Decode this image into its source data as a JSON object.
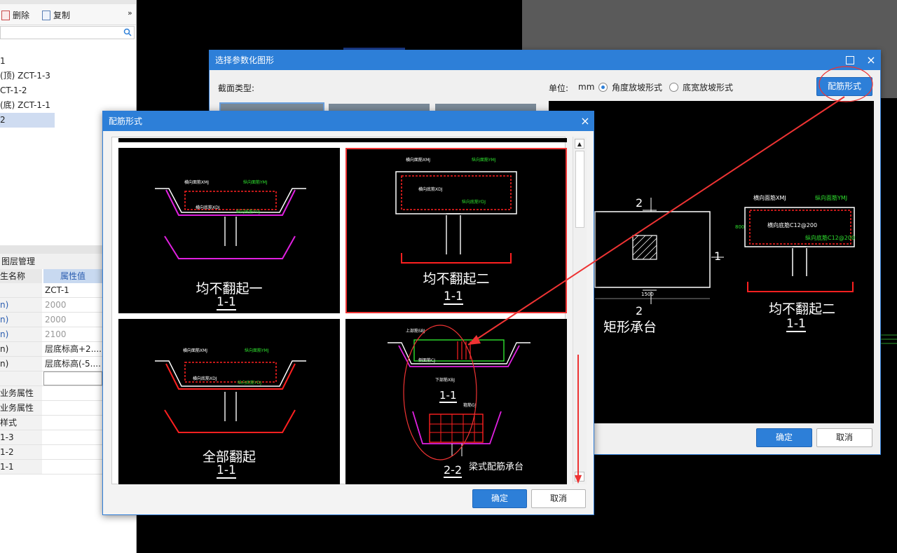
{
  "toolbar": {
    "delete": "删除",
    "copy": "复制",
    "more": "»"
  },
  "tree_items": [
    {
      "label": "1"
    },
    {
      "label": "(顶) ZCT-1-3"
    },
    {
      "label": "CT-1-2"
    },
    {
      "label": "(底) ZCT-1-1"
    },
    {
      "label": "2"
    }
  ],
  "props": {
    "tab_label": "图层管理",
    "header_name": "生名称",
    "header_value": "属性值",
    "rows": [
      {
        "k": "",
        "v": "ZCT-1"
      },
      {
        "k": "n)",
        "v": "2000"
      },
      {
        "k": "n)",
        "v": "2000"
      },
      {
        "k": "n)",
        "v": "2100"
      },
      {
        "k": "n)",
        "v": "层底标高+2...."
      },
      {
        "k": "n)",
        "v": "层底标高(-5...."
      },
      {
        "k": "",
        "v": ""
      },
      {
        "k": "业务属性",
        "v": ""
      },
      {
        "k": "业务属性",
        "v": ""
      },
      {
        "k": "样式",
        "v": ""
      },
      {
        "k": "1-3",
        "v": ""
      },
      {
        "k": "1-2",
        "v": ""
      },
      {
        "k": "1-1",
        "v": ""
      }
    ]
  },
  "dialog_param": {
    "title": "选择参数化图形",
    "section_type_label": "截面类型:",
    "unit_label": "单位:",
    "unit_value": "mm",
    "radio_angle": "角度放坡形式",
    "radio_width": "底宽放坡形式",
    "rebar_button": "配筋形式",
    "ok": "确定",
    "cancel": "取消",
    "preview": {
      "rect_title": "矩形承台",
      "rect_num_top": "2",
      "rect_num_bottom": "2",
      "rect_num_right": "1",
      "dim_1500": "1500",
      "pile_title": "均不翻起二",
      "pile_section": "1-1",
      "ann_xmj": "横向面筋XMJ",
      "ann_ymj": "纵向面筋YMJ",
      "ann_xdj": "横向底筋C12@200",
      "ann_ydj": "纵向底筋C12@200",
      "dim_800": "800"
    }
  },
  "dialog_rebar": {
    "title": "配筋形式",
    "ok": "确定",
    "cancel": "取消",
    "cells": [
      {
        "name": "均不翻起一",
        "section": "1-1",
        "xmj": "横向面筋XMJ",
        "ymj": "纵向面筋YMJ",
        "xdj": "横向底筋XDJ",
        "ydj": "纵向底筋YDJ"
      },
      {
        "name": "均不翻起二",
        "section": "1-1",
        "xmj": "横向面筋XMJ",
        "ymj": "纵向面筋YMJ",
        "xdj": "横向底筋XDJ",
        "ydj": "纵向底筋YDJ"
      },
      {
        "name": "全部翻起",
        "section": "1-1",
        "xmj": "横向面筋XMJ",
        "ymj": "纵向面筋YMJ",
        "xdj": "横向底筋XDJ",
        "ydj": "纵向底筋YDJ"
      },
      {
        "name": "梁式配筋承台",
        "section": "1-1",
        "section2": "2-2",
        "top": "上部筋SBJ",
        "bottom": "下部筋XBJ",
        "side": "侧面筋CJ",
        "stirrup": "箍筋GJ"
      }
    ]
  },
  "colors": {
    "accent": "#2d7fd8",
    "cad_bg": "#000000",
    "highlight": "#e33333",
    "rebar_red": "#ff2020",
    "cad_green": "#2fe02f",
    "cad_magenta": "#e020e0"
  }
}
